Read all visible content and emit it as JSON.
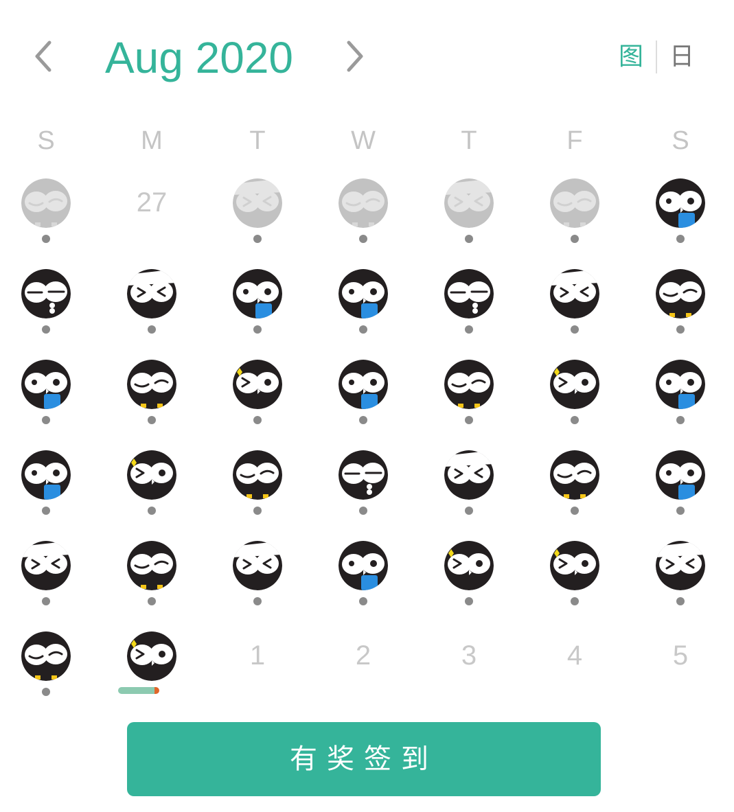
{
  "header": {
    "month_title": "Aug 2020",
    "prev_icon": "chevron-left-icon",
    "next_icon": "chevron-right-icon",
    "view_options": [
      {
        "label": "图",
        "active": true
      },
      {
        "label": "日",
        "active": false
      }
    ]
  },
  "weekdays": [
    "S",
    "M",
    "T",
    "W",
    "T",
    "F",
    "S"
  ],
  "calendar": {
    "weeks": [
      [
        {
          "type": "owl",
          "mood": "wink",
          "faded": true,
          "dot": true
        },
        {
          "type": "number",
          "label": "27"
        },
        {
          "type": "owl",
          "mood": "squint",
          "faded": true,
          "dot": true
        },
        {
          "type": "owl",
          "mood": "wink",
          "faded": true,
          "dot": true
        },
        {
          "type": "owl",
          "mood": "squint",
          "faded": true,
          "dot": true
        },
        {
          "type": "owl",
          "mood": "wink",
          "faded": true,
          "dot": true
        },
        {
          "type": "owl",
          "mood": "book",
          "faded": false,
          "dot": true
        }
      ],
      [
        {
          "type": "owl",
          "mood": "sleepy",
          "dot": true
        },
        {
          "type": "owl",
          "mood": "squint",
          "dot": true
        },
        {
          "type": "owl",
          "mood": "book",
          "dot": true
        },
        {
          "type": "owl",
          "mood": "book",
          "dot": true
        },
        {
          "type": "owl",
          "mood": "sleepy",
          "dot": true
        },
        {
          "type": "owl",
          "mood": "squint",
          "dot": true
        },
        {
          "type": "owl",
          "mood": "wink",
          "dot": true
        }
      ],
      [
        {
          "type": "owl",
          "mood": "book",
          "dot": true
        },
        {
          "type": "owl",
          "mood": "wink",
          "dot": true
        },
        {
          "type": "owl",
          "mood": "sparkle",
          "dot": true
        },
        {
          "type": "owl",
          "mood": "book",
          "dot": true
        },
        {
          "type": "owl",
          "mood": "wink",
          "dot": true
        },
        {
          "type": "owl",
          "mood": "sparkle",
          "dot": true
        },
        {
          "type": "owl",
          "mood": "book",
          "dot": true
        }
      ],
      [
        {
          "type": "owl",
          "mood": "book",
          "dot": true
        },
        {
          "type": "owl",
          "mood": "sparkle",
          "dot": true
        },
        {
          "type": "owl",
          "mood": "wink",
          "dot": true
        },
        {
          "type": "owl",
          "mood": "sleepy",
          "dot": true
        },
        {
          "type": "owl",
          "mood": "squint",
          "dot": true
        },
        {
          "type": "owl",
          "mood": "wink",
          "dot": true
        },
        {
          "type": "owl",
          "mood": "book",
          "dot": true
        }
      ],
      [
        {
          "type": "owl",
          "mood": "squint",
          "dot": true
        },
        {
          "type": "owl",
          "mood": "wink",
          "dot": true
        },
        {
          "type": "owl",
          "mood": "squint",
          "dot": true
        },
        {
          "type": "owl",
          "mood": "book",
          "dot": true
        },
        {
          "type": "owl",
          "mood": "sparkle",
          "dot": true
        },
        {
          "type": "owl",
          "mood": "sparkle",
          "dot": true
        },
        {
          "type": "owl",
          "mood": "squint",
          "dot": true
        }
      ],
      [
        {
          "type": "owl",
          "mood": "wink",
          "dot": true
        },
        {
          "type": "owl",
          "mood": "sparkle",
          "today": true
        },
        {
          "type": "number",
          "label": "1"
        },
        {
          "type": "number",
          "label": "2"
        },
        {
          "type": "number",
          "label": "3"
        },
        {
          "type": "number",
          "label": "4"
        },
        {
          "type": "number",
          "label": "5"
        }
      ]
    ]
  },
  "signin_button": {
    "label": "有奖签到"
  },
  "colors": {
    "accent": "#35b49a",
    "owl_body": "#231f20",
    "owl_faded": "#c2c2c2",
    "book_blue": "#2a8ee0",
    "feet_yellow": "#f5c518",
    "sparkle": "#f3d91a",
    "today_bar": "#8ccab0",
    "today_tip": "#e0662a"
  }
}
